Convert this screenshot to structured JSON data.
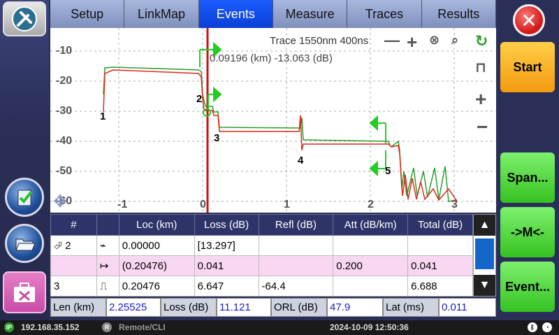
{
  "tabs": [
    "Setup",
    "LinkMap",
    "Events",
    "Measure",
    "Traces",
    "Results"
  ],
  "active_tab": "Events",
  "graph": {
    "trace_label": "Trace",
    "trace_params": "1550nm 400ns",
    "cursor_readout": "0.09196 (km) -13.063 (dB)",
    "y_ticks": [
      "-10",
      "-20",
      "-30",
      "-40",
      "-50",
      "-60"
    ],
    "x_ticks": [
      "-1",
      "0",
      "1",
      "2",
      "3"
    ],
    "event_labels": [
      "1",
      "2",
      "3",
      "4",
      "5"
    ],
    "colors": {
      "trace_green": "#2a9d2a",
      "trace_red": "#e0261a",
      "cursor": "#cc1111",
      "marker": "#22cc22"
    }
  },
  "table": {
    "headers": [
      "#",
      "",
      "Loc (km)",
      "Loss (dB)",
      "Refl (dB)",
      "Att (dB/km)",
      "Total (dB)"
    ],
    "rows": [
      {
        "num": "2",
        "icon": "splice-icon",
        "loc": "0.00000",
        "loss": "[13.297]",
        "refl": "",
        "att": "",
        "total": ""
      },
      {
        "num": "",
        "icon": "section-icon",
        "loc": "(0.20476)",
        "loss": "0.041",
        "refl": "",
        "att": "0.200",
        "total": "0.041"
      },
      {
        "num": "3",
        "icon": "reflective-icon",
        "loc": "0.20476",
        "loss": "6.647",
        "refl": "-64.4",
        "att": "",
        "total": "6.688"
      }
    ]
  },
  "summary": {
    "len_label": "Len (km)",
    "len_value": "2.25525",
    "loss_label": "Loss (dB)",
    "loss_value": "11.121",
    "orl_label": "ORL (dB)",
    "orl_value": "47.9",
    "lat_label": "Lat (ms)",
    "lat_value": "0.011"
  },
  "right": {
    "start": "Start",
    "span": "Span...",
    "marker": "->M<-",
    "event": "Event..."
  },
  "status": {
    "ip": "192.168.35.152",
    "remote": "Remote/CLI",
    "datetime": "2024-10-09  12:50:36"
  }
}
